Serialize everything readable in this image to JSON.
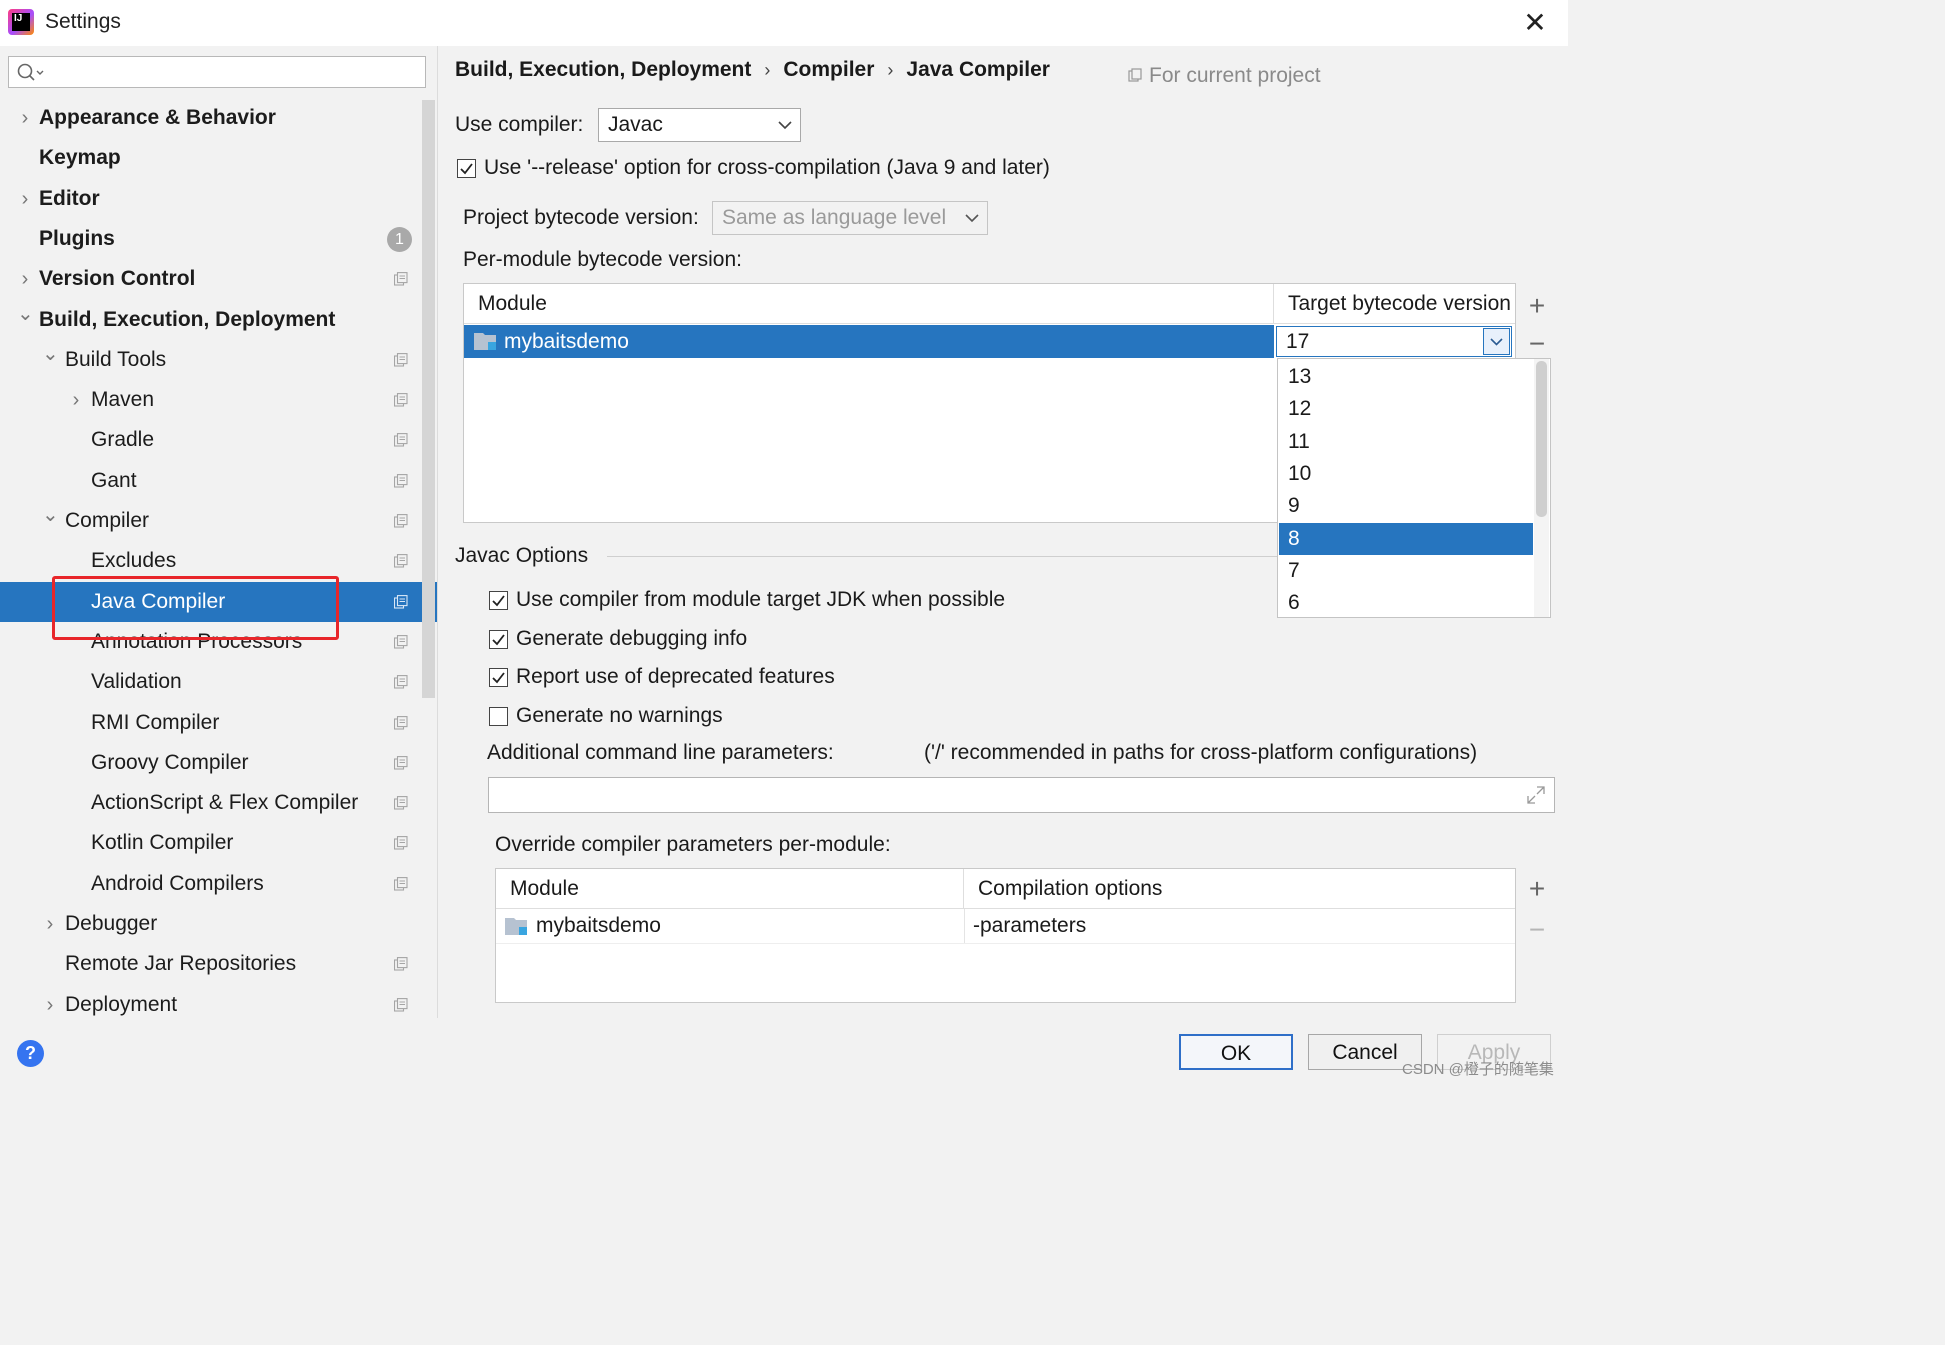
{
  "window": {
    "title": "Settings"
  },
  "sidebar": {
    "items": [
      {
        "label": "Appearance & Behavior",
        "level": 0,
        "bold": true,
        "expand": "collapsed",
        "project": false
      },
      {
        "label": "Keymap",
        "level": 0,
        "bold": true,
        "expand": "none",
        "project": false
      },
      {
        "label": "Editor",
        "level": 0,
        "bold": true,
        "expand": "collapsed",
        "project": false
      },
      {
        "label": "Plugins",
        "level": 0,
        "bold": true,
        "expand": "none",
        "project": false,
        "badge": "1"
      },
      {
        "label": "Version Control",
        "level": 0,
        "bold": true,
        "expand": "collapsed",
        "project": true
      },
      {
        "label": "Build, Execution, Deployment",
        "level": 0,
        "bold": true,
        "expand": "expanded",
        "project": false
      },
      {
        "label": "Build Tools",
        "level": 1,
        "bold": false,
        "expand": "expanded",
        "project": true
      },
      {
        "label": "Maven",
        "level": 2,
        "bold": false,
        "expand": "collapsed",
        "project": true
      },
      {
        "label": "Gradle",
        "level": 2,
        "bold": false,
        "expand": "none",
        "project": true
      },
      {
        "label": "Gant",
        "level": 2,
        "bold": false,
        "expand": "none",
        "project": true
      },
      {
        "label": "Compiler",
        "level": 1,
        "bold": false,
        "expand": "expanded",
        "project": true
      },
      {
        "label": "Excludes",
        "level": 2,
        "bold": false,
        "expand": "none",
        "project": true
      },
      {
        "label": "Java Compiler",
        "level": 2,
        "bold": false,
        "expand": "none",
        "project": true,
        "selected": true
      },
      {
        "label": "Annotation Processors",
        "level": 2,
        "bold": false,
        "expand": "none",
        "project": true
      },
      {
        "label": "Validation",
        "level": 2,
        "bold": false,
        "expand": "none",
        "project": true
      },
      {
        "label": "RMI Compiler",
        "level": 2,
        "bold": false,
        "expand": "none",
        "project": true
      },
      {
        "label": "Groovy Compiler",
        "level": 2,
        "bold": false,
        "expand": "none",
        "project": true
      },
      {
        "label": "ActionScript & Flex Compiler",
        "level": 2,
        "bold": false,
        "expand": "none",
        "project": true
      },
      {
        "label": "Kotlin Compiler",
        "level": 2,
        "bold": false,
        "expand": "none",
        "project": true
      },
      {
        "label": "Android Compilers",
        "level": 2,
        "bold": false,
        "expand": "none",
        "project": true
      },
      {
        "label": "Debugger",
        "level": 1,
        "bold": false,
        "expand": "collapsed",
        "project": false
      },
      {
        "label": "Remote Jar Repositories",
        "level": 1,
        "bold": false,
        "expand": "none",
        "project": true
      },
      {
        "label": "Deployment",
        "level": 1,
        "bold": false,
        "expand": "collapsed",
        "project": true
      }
    ]
  },
  "breadcrumb": [
    "Build, Execution, Deployment",
    "Compiler",
    "Java Compiler"
  ],
  "breadcrumb_sep": "›",
  "scope_label": "For current project",
  "use_compiler": {
    "label": "Use compiler:",
    "value": "Javac"
  },
  "release_option": {
    "label": "Use '--release' option for cross-compilation (Java 9 and later)",
    "checked": true
  },
  "project_bytecode": {
    "label": "Project bytecode version:",
    "value": "Same as language level"
  },
  "per_module": {
    "label": "Per-module bytecode version:",
    "col_module": "Module",
    "col_target": "Target bytecode version",
    "row_module": "mybaitsdemo",
    "row_value": "17",
    "options": [
      "13",
      "12",
      "11",
      "10",
      "9",
      "8",
      "7",
      "6"
    ],
    "highlighted_option": "8"
  },
  "javac": {
    "title": "Javac Options",
    "options": [
      {
        "label": "Use compiler from module target JDK when possible",
        "checked": true
      },
      {
        "label": "Generate debugging info",
        "checked": true
      },
      {
        "label": "Report use of deprecated features",
        "checked": true
      },
      {
        "label": "Generate no warnings",
        "checked": false
      }
    ],
    "cmdline_label": "Additional command line parameters:",
    "cmdline_hint": "('/' recommended in paths for cross-platform configurations)",
    "cmdline_value": ""
  },
  "override": {
    "label": "Override compiler parameters per-module:",
    "col_module": "Module",
    "col_options": "Compilation options",
    "row_module": "mybaitsdemo",
    "row_options": "-parameters"
  },
  "table_buttons": {
    "add": "+",
    "remove": "−"
  },
  "footer": {
    "help": "?",
    "ok": "OK",
    "cancel": "Cancel",
    "apply": "Apply"
  },
  "watermark": "CSDN @橙子的随笔集",
  "colors": {
    "selection": "#2675bf",
    "highlight_box": "#e8262a",
    "help": "#3574f0"
  }
}
